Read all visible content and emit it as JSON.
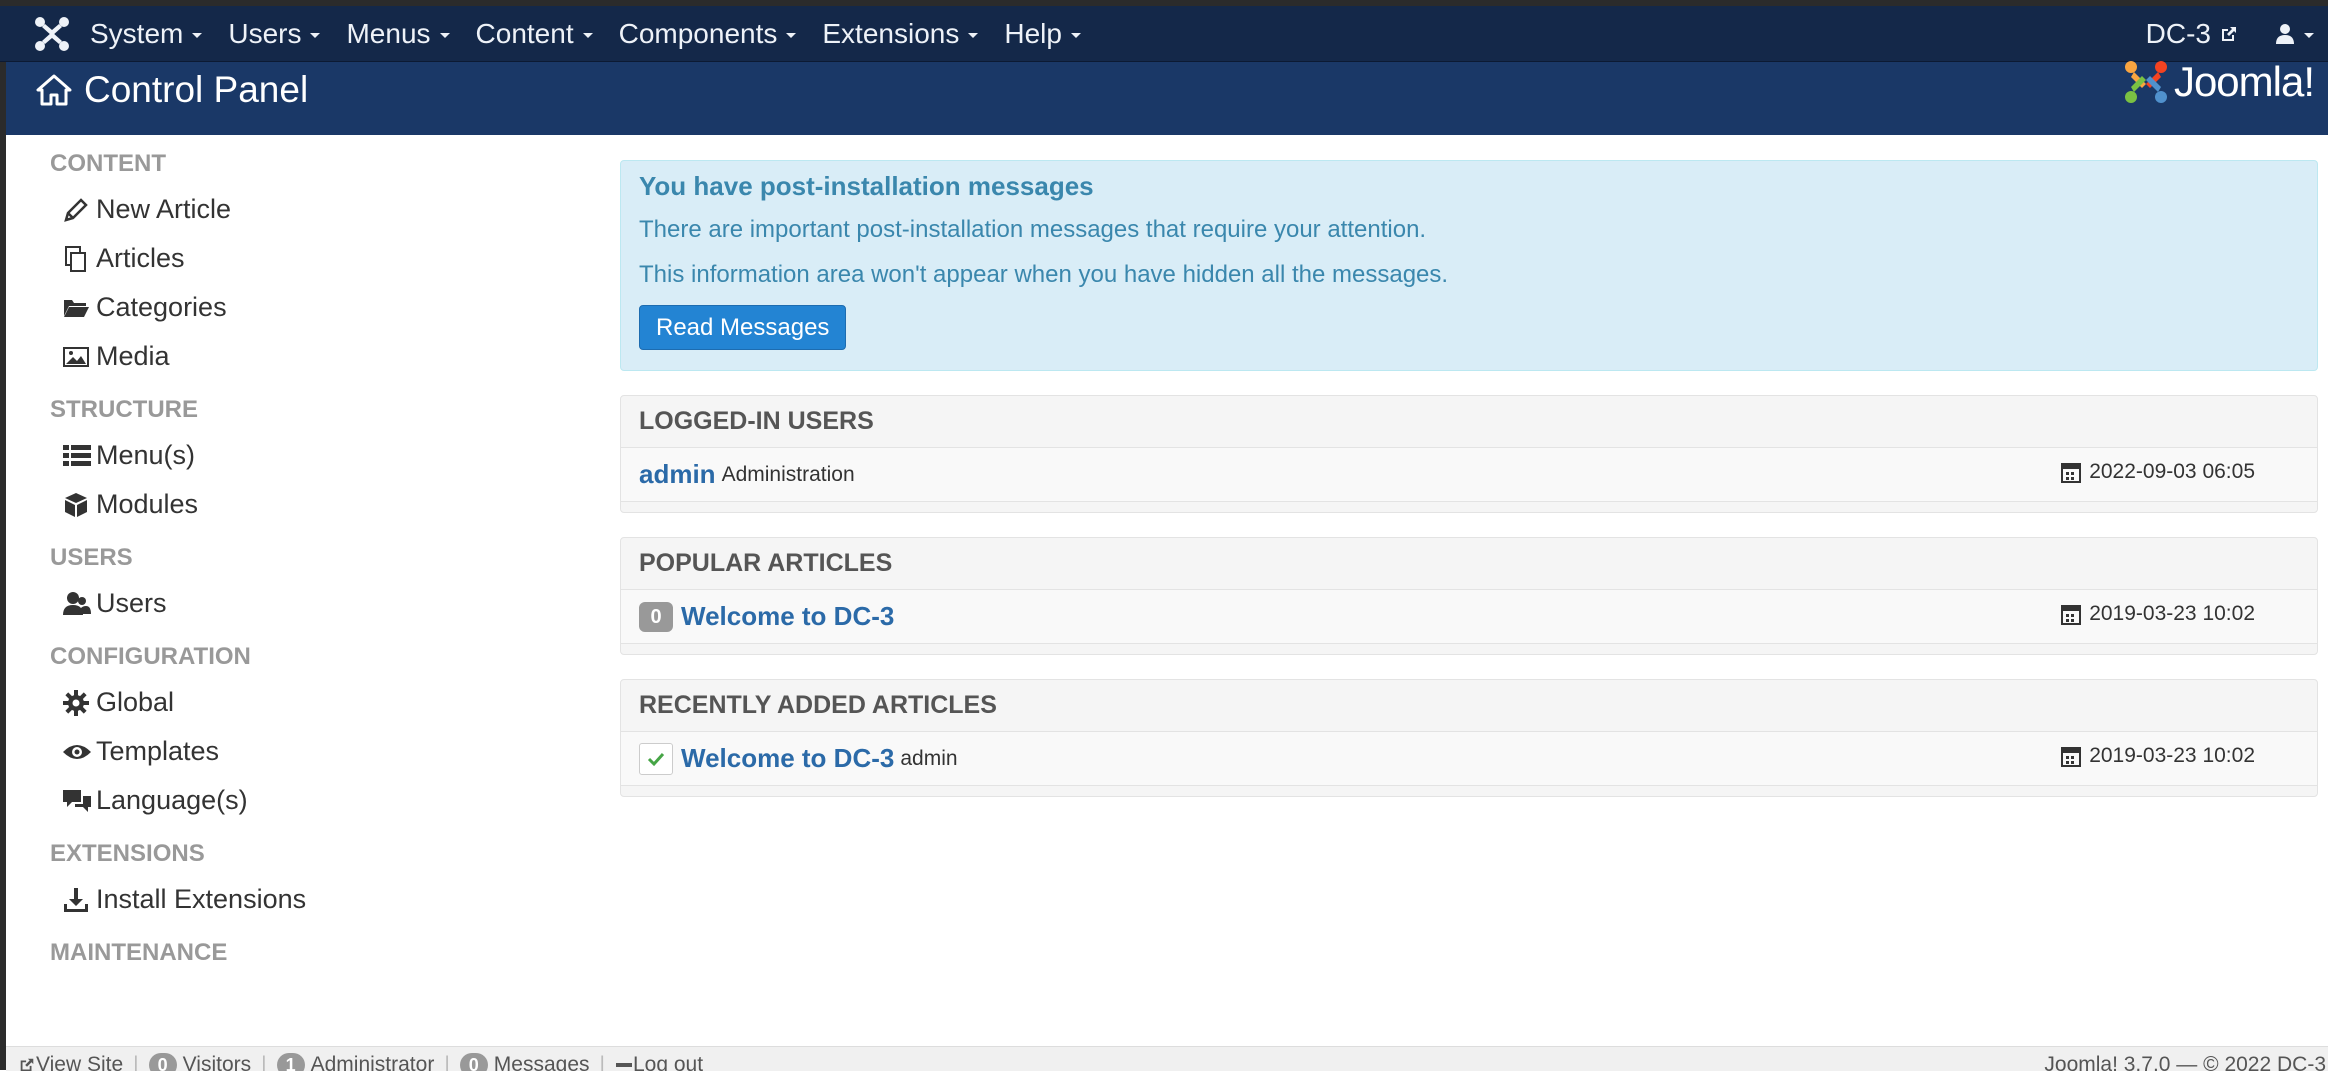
{
  "navbar": {
    "menu": [
      "System",
      "Users",
      "Menus",
      "Content",
      "Components",
      "Extensions",
      "Help"
    ],
    "site_name": "DC-3"
  },
  "header": {
    "title": "Control Panel",
    "logo_text": "Joomla!"
  },
  "sidebar": {
    "sections": [
      {
        "heading": "CONTENT",
        "items": [
          {
            "label": "New Article",
            "icon": "pencil-icon"
          },
          {
            "label": "Articles",
            "icon": "copy-icon"
          },
          {
            "label": "Categories",
            "icon": "folder-open-icon"
          },
          {
            "label": "Media",
            "icon": "image-icon"
          }
        ]
      },
      {
        "heading": "STRUCTURE",
        "items": [
          {
            "label": "Menu(s)",
            "icon": "list-icon"
          },
          {
            "label": "Modules",
            "icon": "cube-icon"
          }
        ]
      },
      {
        "heading": "USERS",
        "items": [
          {
            "label": "Users",
            "icon": "users-icon"
          }
        ]
      },
      {
        "heading": "CONFIGURATION",
        "items": [
          {
            "label": "Global",
            "icon": "gear-icon"
          },
          {
            "label": "Templates",
            "icon": "eye-icon"
          },
          {
            "label": "Language(s)",
            "icon": "comments-icon"
          }
        ]
      },
      {
        "heading": "EXTENSIONS",
        "items": [
          {
            "label": "Install Extensions",
            "icon": "download-icon"
          }
        ]
      },
      {
        "heading": "MAINTENANCE",
        "items": []
      }
    ]
  },
  "alert": {
    "title": "You have post-installation messages",
    "line1": "There are important post-installation messages that require your attention.",
    "line2": "This information area won't appear when you have hidden all the messages.",
    "button": "Read Messages"
  },
  "logged_in": {
    "heading": "LOGGED-IN USERS",
    "user": "admin",
    "area": "Administration",
    "date": "2022-09-03 06:05"
  },
  "popular": {
    "heading": "POPULAR ARTICLES",
    "hits": "0",
    "title": "Welcome to DC-3",
    "date": "2019-03-23 10:02"
  },
  "recent": {
    "heading": "RECENTLY ADDED ARTICLES",
    "title": "Welcome to DC-3",
    "author": "admin",
    "date": "2019-03-23 10:02"
  },
  "statusbar": {
    "view_site": "View Site",
    "visitors_count": "0",
    "visitors_label": "Visitors",
    "admin_count": "1",
    "admin_label": "Administrator",
    "messages_count": "0",
    "messages_label": "Messages",
    "logout": "Log out",
    "right": "Joomla! 3.7.0 — © 2022 DC-3"
  },
  "colors": {
    "navbar": "#142849",
    "header": "#1a3867",
    "link": "#2b6aa8",
    "alert_bg": "#d9edf7",
    "button": "#2384d3"
  }
}
